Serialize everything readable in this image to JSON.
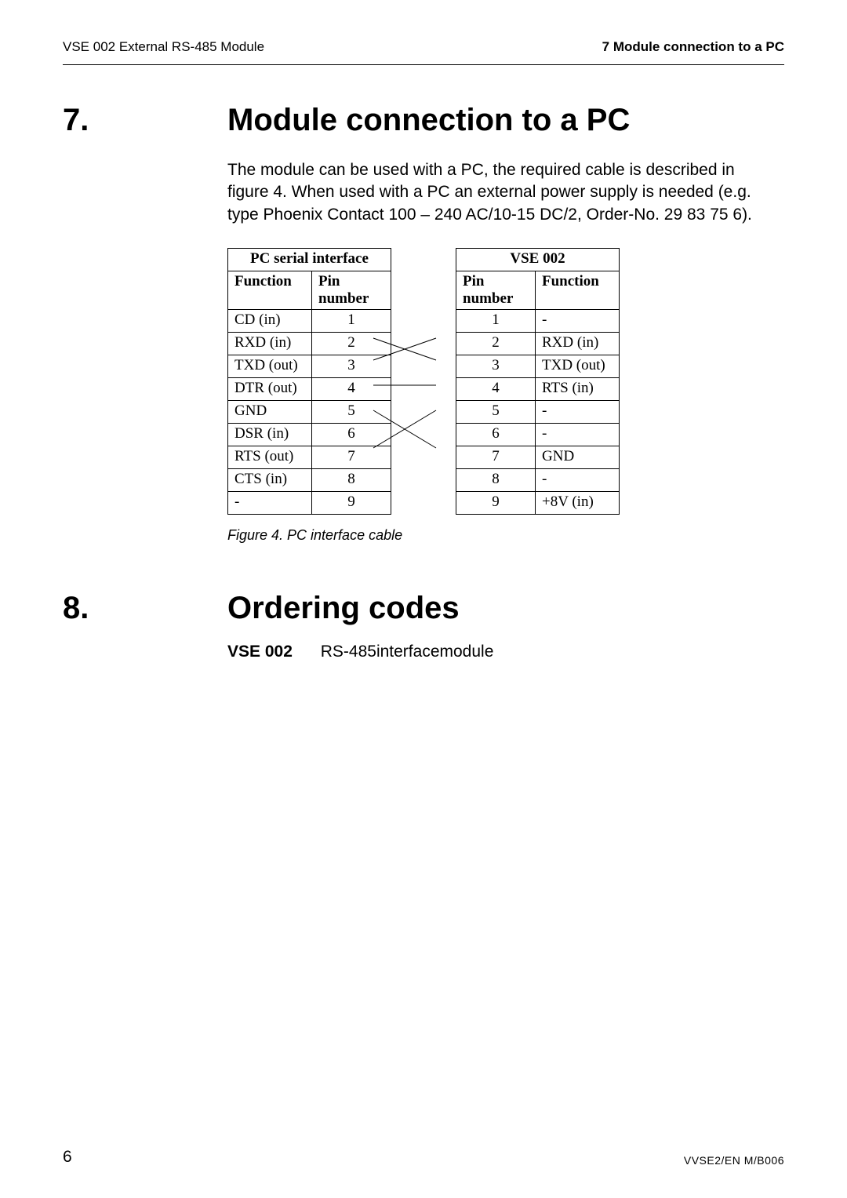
{
  "header": {
    "left": "VSE 002 External RS-485 Module",
    "right": "7 Module connection to a PC"
  },
  "section7": {
    "number": "7.",
    "title": "Module connection to a PC",
    "paragraph": "The module can be used with a PC, the required cable is described in figure 4. When used with a PC an external power supply is needed (e.g. type Phoenix Contact 100 – 240 AC/10-15 DC/2, Order-No. 29 83 75 6)."
  },
  "figure4": {
    "caption": "Figure 4. PC interface cable",
    "left_title": "PC serial interface",
    "right_title": "VSE 002",
    "col_labels": {
      "function": "Function",
      "pin": "Pin number"
    },
    "left_rows": [
      {
        "fn": "CD (in)",
        "pin": "1"
      },
      {
        "fn": "RXD (in)",
        "pin": "2"
      },
      {
        "fn": "TXD (out)",
        "pin": "3"
      },
      {
        "fn": "DTR (out)",
        "pin": "4"
      },
      {
        "fn": "GND",
        "pin": "5"
      },
      {
        "fn": "DSR (in)",
        "pin": "6"
      },
      {
        "fn": "RTS (out)",
        "pin": "7"
      },
      {
        "fn": "CTS (in)",
        "pin": "8"
      },
      {
        "fn": "-",
        "pin": "9"
      }
    ],
    "right_rows": [
      {
        "pin": "1",
        "fn": "-"
      },
      {
        "pin": "2",
        "fn": "RXD (in)"
      },
      {
        "pin": "3",
        "fn": "TXD (out)"
      },
      {
        "pin": "4",
        "fn": "RTS (in)"
      },
      {
        "pin": "5",
        "fn": "-"
      },
      {
        "pin": "6",
        "fn": "-"
      },
      {
        "pin": "7",
        "fn": "GND"
      },
      {
        "pin": "8",
        "fn": "-"
      },
      {
        "pin": "9",
        "fn": "+8V (in)"
      }
    ]
  },
  "section8": {
    "number": "8.",
    "title": "Ordering codes",
    "item_code": "VSE 002",
    "item_desc": "RS-485interfacemodule"
  },
  "footer": {
    "page": "6",
    "doc": "VVSE2/EN M/B006"
  }
}
